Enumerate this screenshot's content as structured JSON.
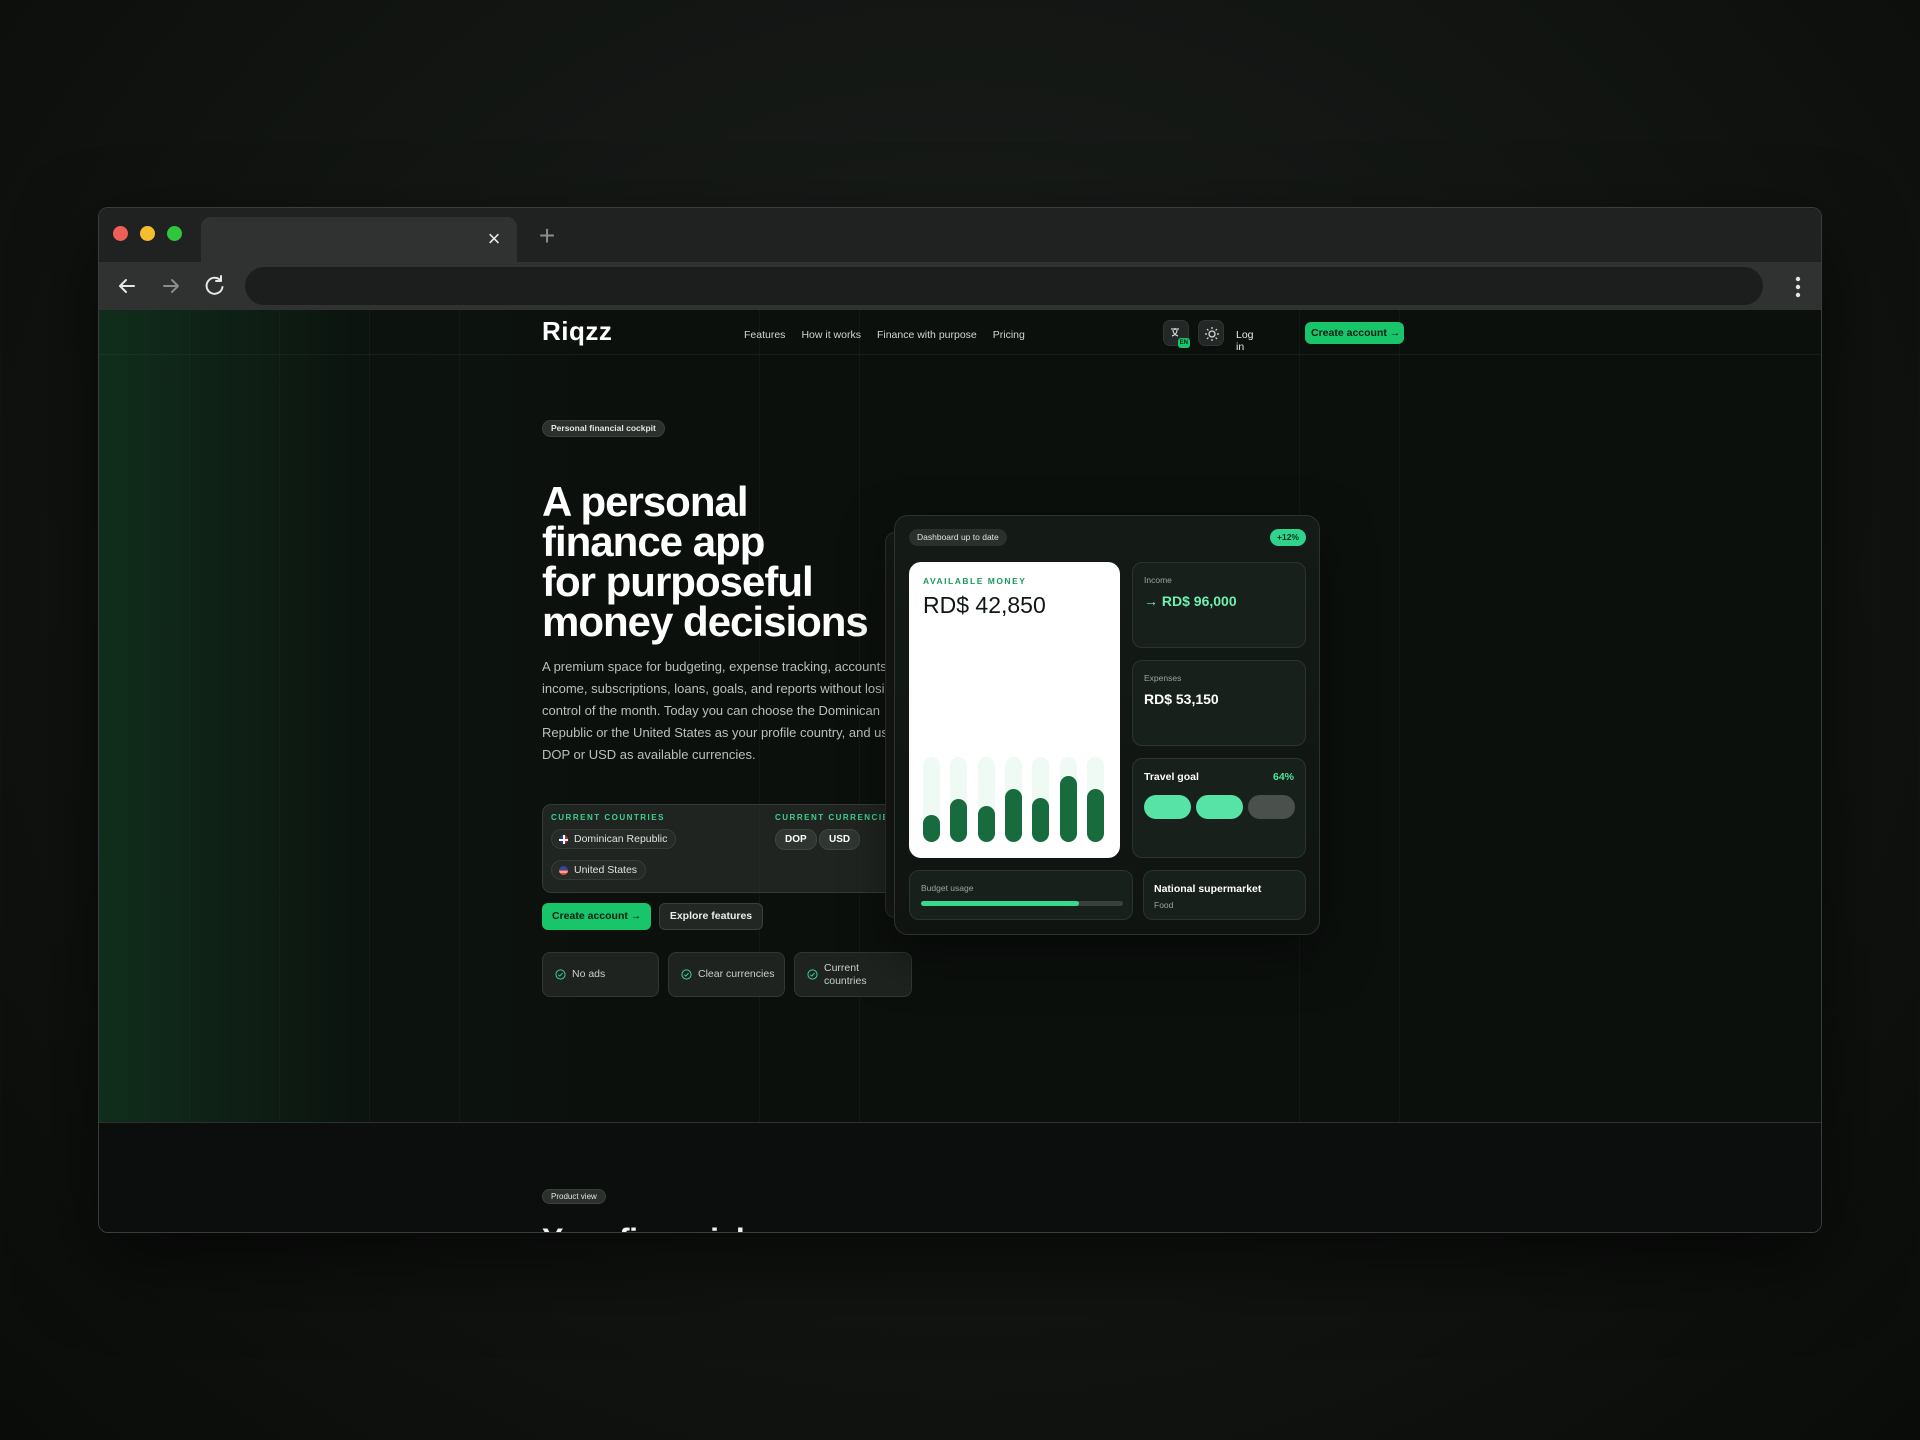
{
  "site": {
    "logo": "Riqzz",
    "nav": [
      "Features",
      "How it works",
      "Finance with purpose",
      "Pricing"
    ],
    "login": "Log in",
    "create_account": "Create account →",
    "lang_badge": "EN"
  },
  "hero": {
    "tag": "Personal financial cockpit",
    "title_lines": [
      "A personal",
      "finance app",
      "for purposeful",
      "money decisions"
    ],
    "description": "A premium space for budgeting, expense tracking, accounts, income, subscriptions, loans, goals, and reports without losing control of the month. Today you can choose the Dominican Republic or the United States as your profile country, and use DOP or USD as available currencies.",
    "countries_label": "CURRENT COUNTRIES",
    "currencies_label": "CURRENT CURRENCIES",
    "countries": [
      "Dominican Republic",
      "United States"
    ],
    "currencies": [
      "DOP",
      "USD"
    ],
    "primary_cta": "Create account →",
    "secondary_cta": "Explore features",
    "features": [
      "No ads",
      "Clear currencies",
      "Current countries"
    ]
  },
  "dashboard": {
    "tag": "Dashboard up to date",
    "badge": "+12%",
    "available_label": "AVAILABLE MONEY",
    "available_value": "RD$ 42,850",
    "bars": [
      0.32,
      0.5,
      0.42,
      0.62,
      0.52,
      0.78,
      0.62
    ],
    "income_label": "Income",
    "income_value": "→ RD$ 96,000",
    "expenses_label": "Expenses",
    "expenses_value": "RD$ 53,150",
    "goal_label": "Travel goal",
    "goal_percent": "64%",
    "goal_segments_filled": 2,
    "goal_segments_total": 3,
    "budget_label": "Budget usage",
    "budget_fraction": 0.78,
    "merchant_name": "National supermarket",
    "merchant_category": "Food"
  },
  "section2": {
    "tag": "Product view",
    "title": "Your financial"
  },
  "colors": {
    "accent": "#19c56a",
    "accent_light": "#36d98f",
    "bar": "#176b3c",
    "mac_red": "#ee5f57",
    "mac_yellow": "#f5bd2f",
    "mac_green": "#2fc63e"
  }
}
